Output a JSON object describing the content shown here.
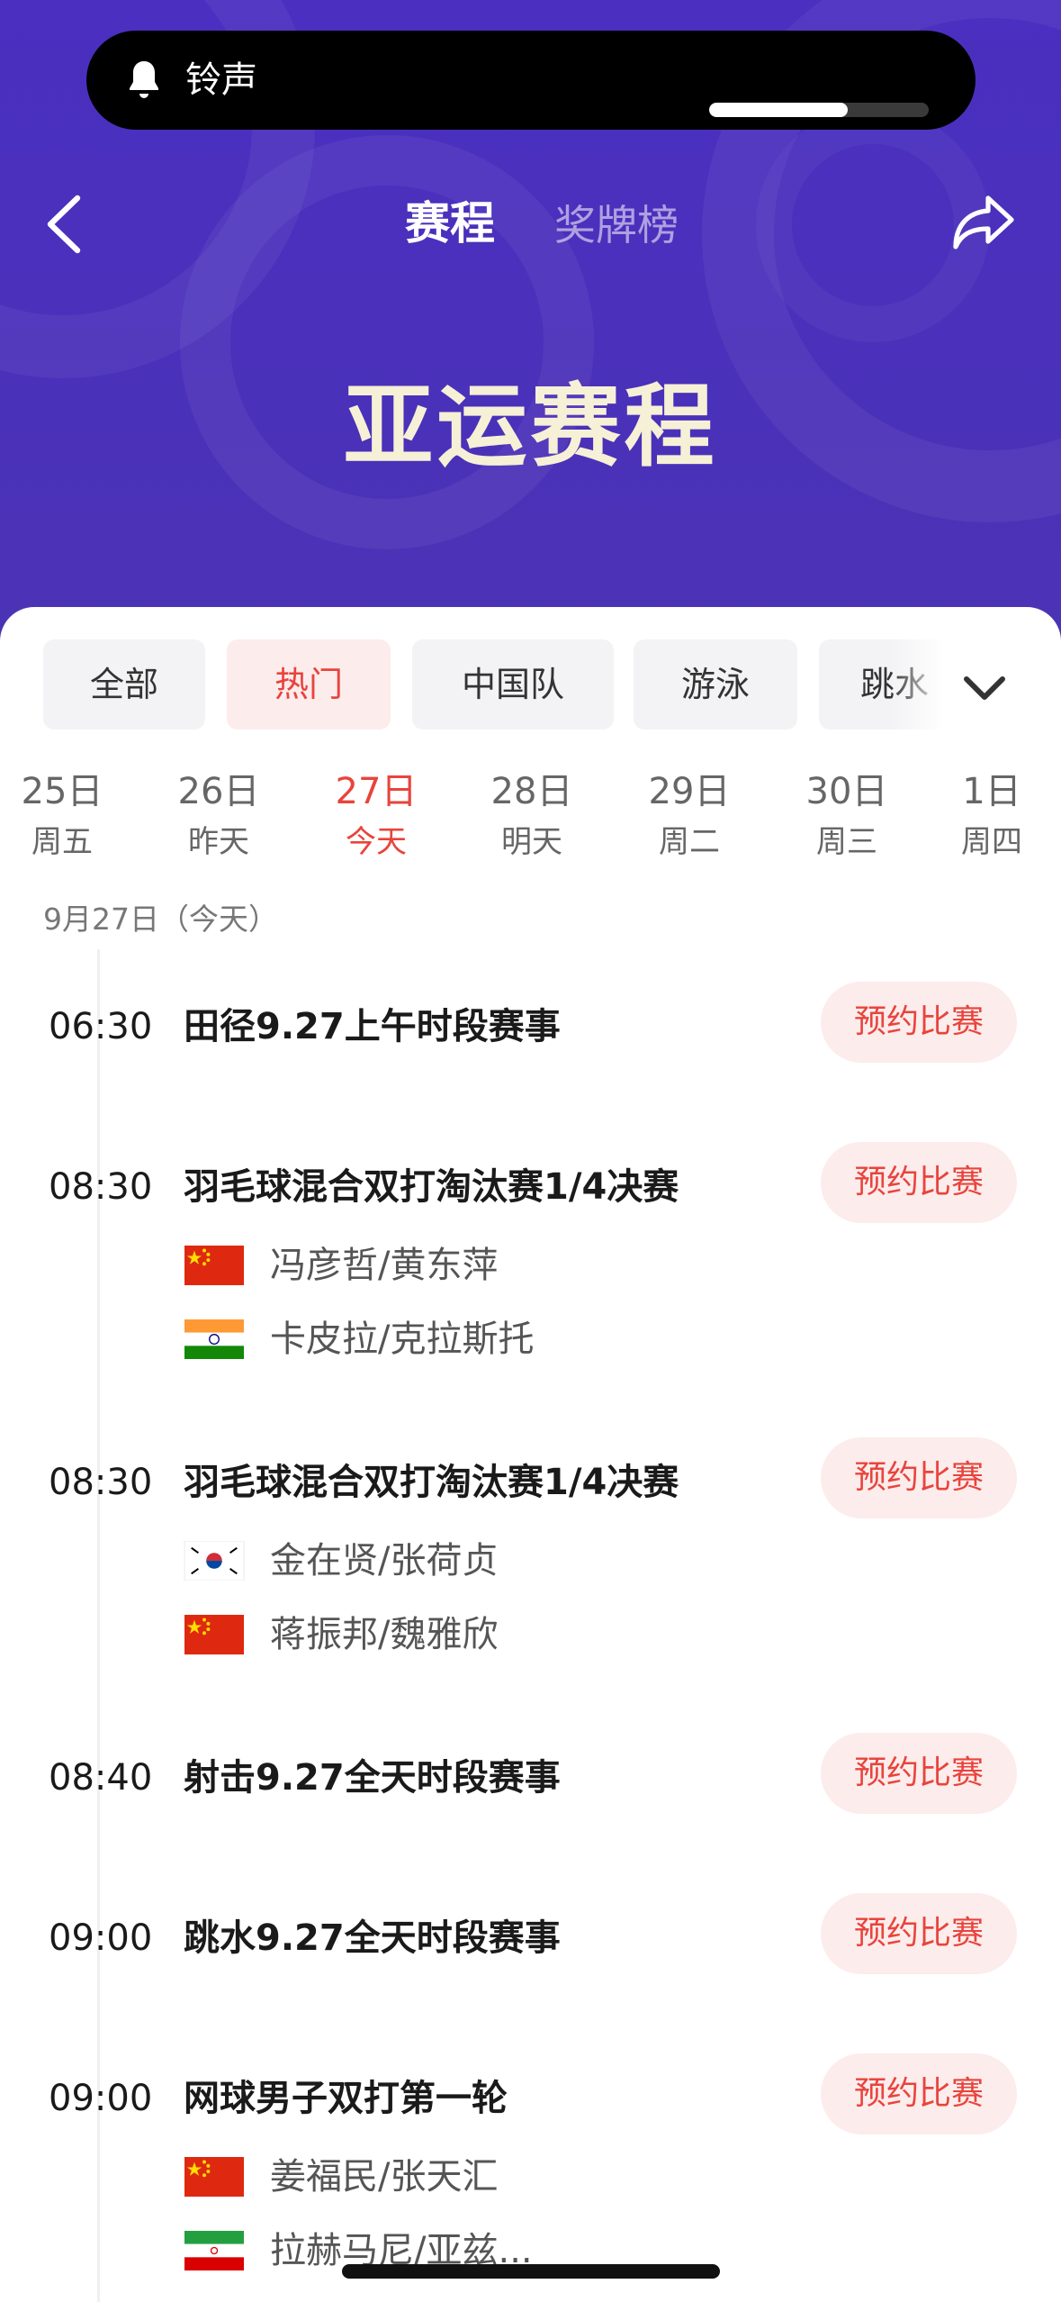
{
  "ringer": {
    "label": "铃声",
    "volume_fraction": 0.63
  },
  "header": {
    "tabs": [
      {
        "label": "赛程",
        "active": true
      },
      {
        "label": "奖牌榜",
        "active": false
      }
    ],
    "title": "亚运赛程"
  },
  "filters": [
    "全部",
    "热门",
    "中国队",
    "游泳",
    "跳水"
  ],
  "active_filter": "热门",
  "dates": [
    {
      "day": "25日",
      "weekday": "周五"
    },
    {
      "day": "26日",
      "weekday": "昨天"
    },
    {
      "day": "27日",
      "weekday": "今天",
      "active": true
    },
    {
      "day": "28日",
      "weekday": "明天"
    },
    {
      "day": "29日",
      "weekday": "周二"
    },
    {
      "day": "30日",
      "weekday": "周三"
    },
    {
      "day": "1日",
      "weekday": "周四"
    }
  ],
  "date_header": "9月27日（今天）",
  "reserve_label": "预约比赛",
  "events": [
    {
      "time": "06:30",
      "title": "田径9.27上午时段赛事",
      "players": []
    },
    {
      "time": "08:30",
      "title": "羽毛球混合双打淘汰赛1/4决赛",
      "players": [
        {
          "flag": "china-flag",
          "name": "冯彦哲/黄东萍"
        },
        {
          "flag": "india-flag",
          "name": "卡皮拉/克拉斯托"
        }
      ]
    },
    {
      "time": "08:30",
      "title": "羽毛球混合双打淘汰赛1/4决赛",
      "players": [
        {
          "flag": "korea-flag",
          "name": "金在贤/张荷贞"
        },
        {
          "flag": "china-flag",
          "name": "蒋振邦/魏雅欣"
        }
      ]
    },
    {
      "time": "08:40",
      "title": "射击9.27全天时段赛事",
      "players": []
    },
    {
      "time": "09:00",
      "title": "跳水9.27全天时段赛事",
      "players": []
    },
    {
      "time": "09:00",
      "title": "网球男子双打第一轮",
      "players": [
        {
          "flag": "china-flag",
          "name": "姜福民/张天汇"
        },
        {
          "flag": "iran-flag",
          "name": "拉赫马尼/亚兹..."
        }
      ]
    }
  ],
  "colors": {
    "header_bg": "#4a2fc0",
    "accent": "#e8443c",
    "chip_bg": "#f3f3f5",
    "reserve_bg": "#fdecec",
    "title_cream": "#f6f0d6"
  }
}
